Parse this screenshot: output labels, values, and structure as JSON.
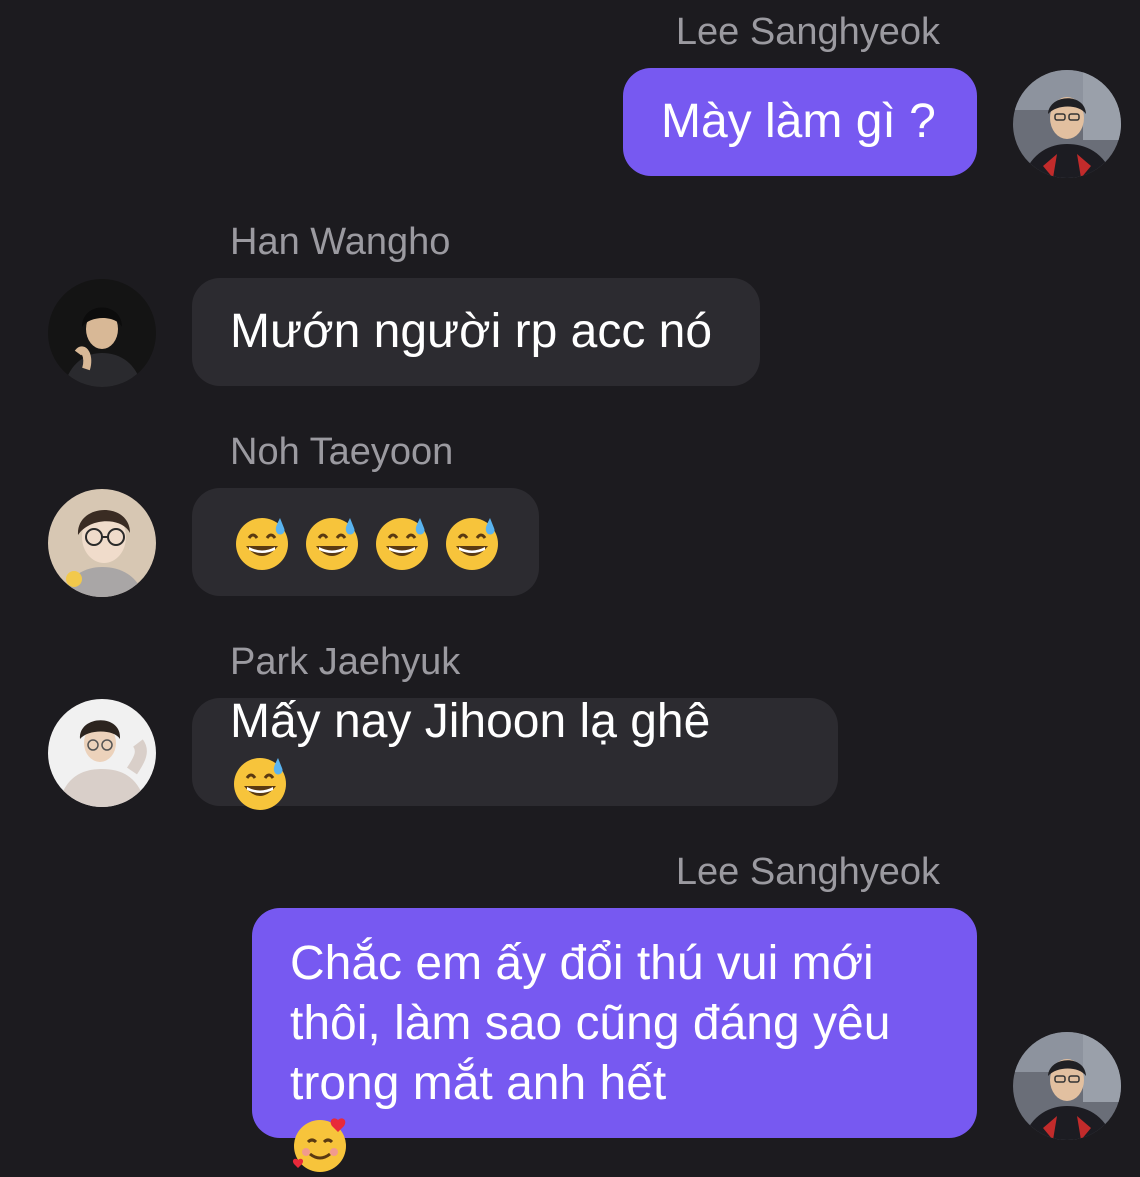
{
  "messages": [
    {
      "sender": "Lee Sanghyeok",
      "text": "Mày làm gì ?",
      "direction": "outgoing"
    },
    {
      "sender": "Han Wangho",
      "text": "Mướn người rp acc nó",
      "direction": "incoming"
    },
    {
      "sender": "Noh Taeyoon",
      "emojis": [
        "grinning-sweat-emoji",
        "grinning-sweat-emoji",
        "grinning-sweat-emoji",
        "grinning-sweat-emoji"
      ],
      "direction": "incoming"
    },
    {
      "sender": "Park Jaehyuk",
      "text": "Mấy nay Jihoon lạ ghê",
      "trailing_emoji": "grinning-sweat-emoji",
      "direction": "incoming"
    },
    {
      "sender": "Lee Sanghyeok",
      "lines": [
        "Chắc em ấy đổi thú vui mới",
        "thôi, làm sao cũng đáng yêu",
        "trong mắt anh hết"
      ],
      "trailing_emoji": "smiling-hearts-emoji",
      "direction": "outgoing"
    }
  ],
  "colors": {
    "background": "#1c1b1f",
    "incoming_bubble": "#2c2b30",
    "outgoing_bubble": "#7759f1",
    "sender_name": "#9b9aa0",
    "text": "#ffffff"
  }
}
